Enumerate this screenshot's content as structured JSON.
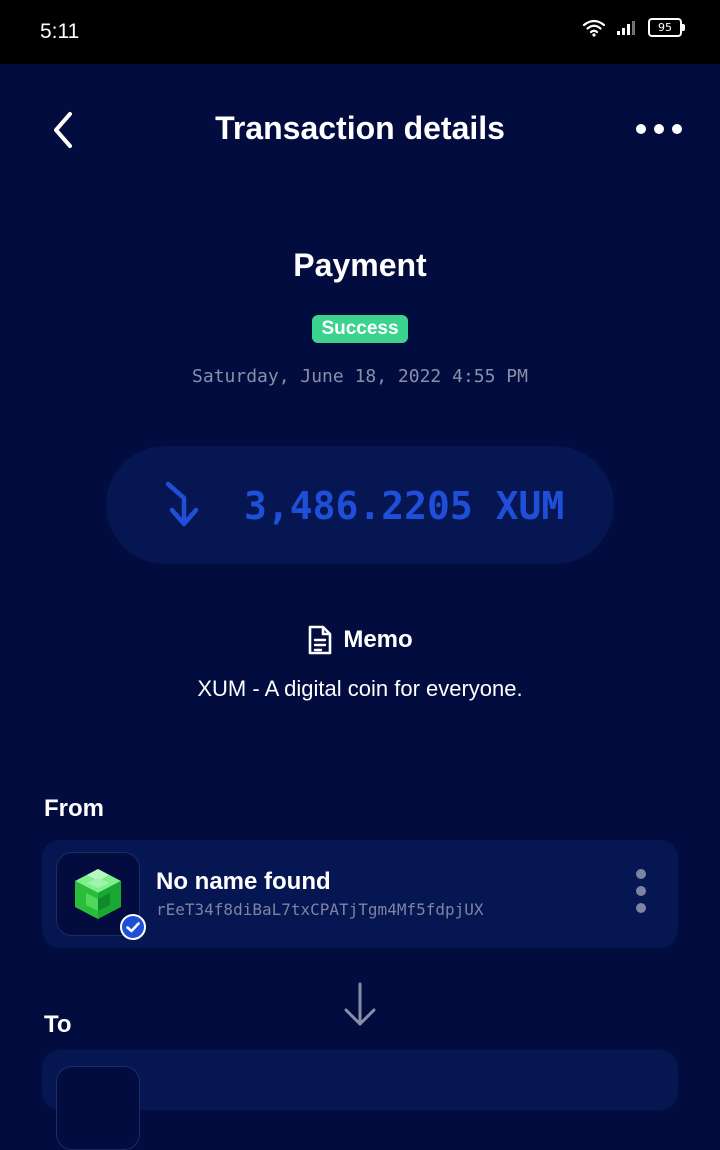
{
  "status_bar": {
    "time": "5:11",
    "battery": "95"
  },
  "header": {
    "title": "Transaction details",
    "back_icon": "chevron-left-icon",
    "more_icon": "more-horizontal-icon"
  },
  "transaction": {
    "type": "Payment",
    "status": "Success",
    "date": "Saturday, June 18, 2022 4:55 PM",
    "amount": "3,486.2205 XUM",
    "direction_icon": "incoming-arrow-icon"
  },
  "memo": {
    "title": "Memo",
    "text": "XUM - A digital coin for everyone."
  },
  "from": {
    "label": "From",
    "name": "No name found",
    "address": "rEeT34f8diBaL7txCPATjTgm4Mf5fdpjUX"
  },
  "to": {
    "label": "To"
  },
  "colors": {
    "background": "#030c3f",
    "card": "#061652",
    "success": "#3bd38e",
    "amount": "#1f4fd8",
    "muted": "#8a8fa8"
  }
}
